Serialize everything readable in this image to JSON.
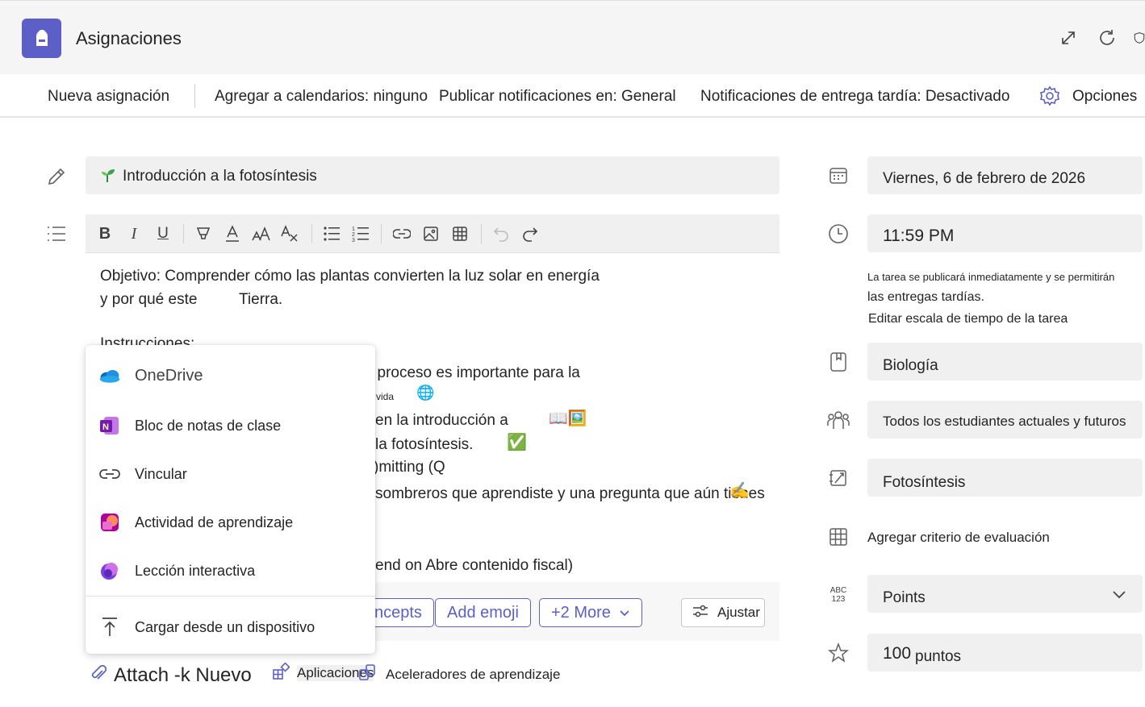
{
  "header": {
    "title": "Asignaciones",
    "accent_color": "#5b5fc7",
    "icons": [
      "popout-icon",
      "refresh-icon",
      "shield-icon"
    ]
  },
  "toolbar": {
    "new_assignment": "Nueva asignación",
    "add_calendars": "Agregar a calendarios: ninguno",
    "post_notifications": "Publicar notificaciones en: General",
    "late_notifications": "Notificaciones de entrega tardía: Desactivado",
    "options": "Opciones"
  },
  "assignment": {
    "title": "Introducción a la fotosíntesis",
    "body_lines": {
      "l1": "Objetivo: Comprender cómo las plantas convierten la luz solar en energía",
      "l2a": "y por qué este",
      "l2b": "Tierra.",
      "l3": "Instrucciones:",
      "l4": "l proceso es importante para la",
      "l5": "vida",
      "l6": "en la introducción a",
      "l7": "la fotosíntesis.",
      "l8": ")mitting (Q",
      "l9": "sombreros que aprendiste y una pregunta que aún tienes",
      "l10": "end on Abre contenido fiscal)"
    },
    "emojis": {
      "globe": "🌐",
      "books": "📖🖼️",
      "check": "✅",
      "writing": "✍"
    },
    "chips": {
      "concepts": "ncepts",
      "add_emoji": "Add emoji",
      "more": "+2 More"
    },
    "adjust_label": "Ajustar"
  },
  "attach_menu": {
    "items": [
      {
        "label": "OneDrive",
        "icon": "onedrive-icon"
      },
      {
        "label": "Bloc de notas de clase",
        "icon": "onenote-icon"
      },
      {
        "label": "Vincular",
        "icon": "link-icon"
      },
      {
        "label": "Actividad de aprendizaje",
        "icon": "learning-activity-icon"
      },
      {
        "label": "Lección interactiva",
        "icon": "interactive-lesson-icon"
      },
      {
        "label": "Cargar desde un dispositivo",
        "icon": "upload-icon"
      }
    ]
  },
  "attach_row": {
    "attach": "Attach -k Nuevo",
    "apps": "Aplicaciones",
    "accelerators": "Aceleradores de aprendizaje"
  },
  "right_panel": {
    "due_date": "Viernes, 6 de febrero de 2026",
    "due_time": "11:59 PM",
    "note_line1": "La tarea se publicará inmediatamente y se permitirán",
    "note_line2": "las entregas tardías.",
    "edit_timeline": "Editar escala de tiempo de la tarea",
    "class": "Biología",
    "assign_to": "Todos los estudiantes actuales y futuros",
    "category": "Fotosíntesis",
    "add_rubric": "Agregar criterio de evaluación",
    "grading": "Points",
    "points_value": "100",
    "points_unit": "puntos",
    "grading_icon_text_top": "ABC",
    "grading_icon_text_bottom": "123"
  }
}
